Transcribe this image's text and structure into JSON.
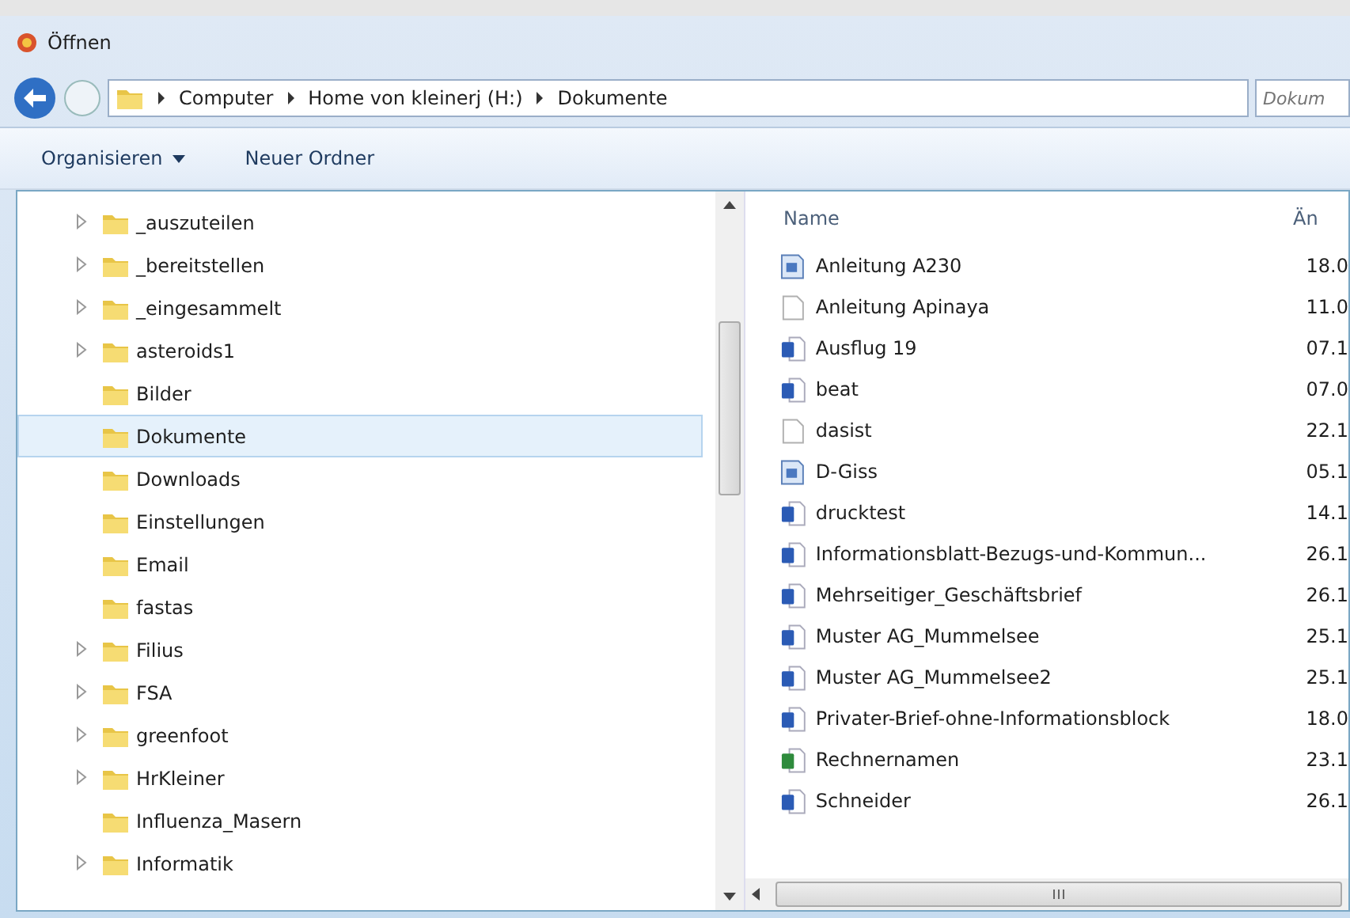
{
  "window": {
    "title": "Öffnen"
  },
  "address_bar": {
    "crumbs": [
      "Computer",
      "Home von kleinerj (H:)",
      "Dokumente"
    ],
    "search_placeholder": "Dokum"
  },
  "toolbar": {
    "buttons": [
      {
        "label": "Organisieren",
        "dropdown": true
      },
      {
        "label": "Neuer Ordner",
        "dropdown": false
      }
    ]
  },
  "folder_tree": [
    {
      "label": "_auszuteilen",
      "has_children": true,
      "selected": false
    },
    {
      "label": "_bereitstellen",
      "has_children": true,
      "selected": false
    },
    {
      "label": "_eingesammelt",
      "has_children": true,
      "selected": false
    },
    {
      "label": "asteroids1",
      "has_children": true,
      "selected": false
    },
    {
      "label": "Bilder",
      "has_children": false,
      "selected": false
    },
    {
      "label": "Dokumente",
      "has_children": false,
      "selected": true
    },
    {
      "label": "Downloads",
      "has_children": false,
      "selected": false
    },
    {
      "label": "Einstellungen",
      "has_children": false,
      "selected": false
    },
    {
      "label": "Email",
      "has_children": false,
      "selected": false
    },
    {
      "label": "fastas",
      "has_children": false,
      "selected": false
    },
    {
      "label": "Filius",
      "has_children": true,
      "selected": false
    },
    {
      "label": "FSA",
      "has_children": true,
      "selected": false
    },
    {
      "label": "greenfoot",
      "has_children": true,
      "selected": false
    },
    {
      "label": "HrKleiner",
      "has_children": true,
      "selected": false
    },
    {
      "label": "Influenza_Masern",
      "has_children": false,
      "selected": false
    },
    {
      "label": "Informatik",
      "has_children": true,
      "selected": false
    }
  ],
  "file_list": {
    "columns": [
      "Name",
      "Än"
    ],
    "rows": [
      {
        "kind": "image",
        "name": "Anleitung A230",
        "column_2": "18.0"
      },
      {
        "kind": "blank",
        "name": "Anleitung Apinaya",
        "column_2": "11.0"
      },
      {
        "kind": "word",
        "name": "Ausflug 19",
        "column_2": "07.1"
      },
      {
        "kind": "word",
        "name": "beat",
        "column_2": "07.0"
      },
      {
        "kind": "blank",
        "name": "dasist",
        "column_2": "22.1"
      },
      {
        "kind": "image",
        "name": "D-Giss",
        "column_2": "05.1"
      },
      {
        "kind": "word",
        "name": "drucktest",
        "column_2": "14.1"
      },
      {
        "kind": "word",
        "name": "Informationsblatt-Bezugs-und-Kommun...",
        "column_2": "26.1"
      },
      {
        "kind": "word",
        "name": "Mehrseitiger_Geschäftsbrief",
        "column_2": "26.1"
      },
      {
        "kind": "word",
        "name": "Muster AG_Mummelsee",
        "column_2": "25.1"
      },
      {
        "kind": "word",
        "name": "Muster AG_Mummelsee2",
        "column_2": "25.1"
      },
      {
        "kind": "word",
        "name": "Privater-Brief-ohne-Informationsblock",
        "column_2": "18.0"
      },
      {
        "kind": "excel",
        "name": "Rechnernamen",
        "column_2": "23.1"
      },
      {
        "kind": "word",
        "name": "Schneider",
        "column_2": "26.1"
      }
    ]
  }
}
